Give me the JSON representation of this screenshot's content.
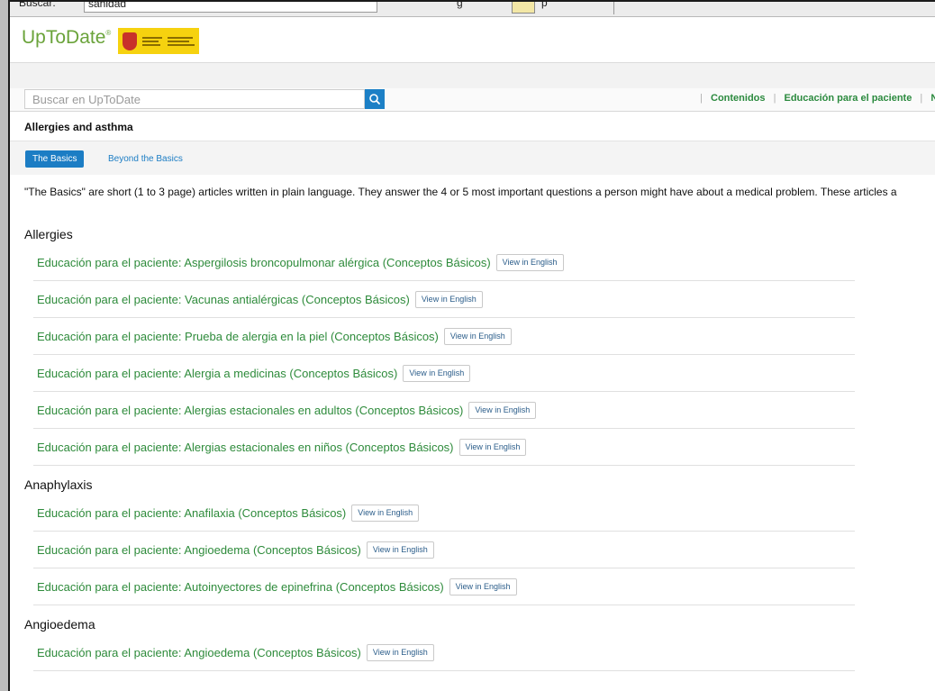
{
  "browser_top": {
    "search_label": "Buscar:",
    "search_value": "sanidad",
    "mid_text": "g",
    "right_text": "p"
  },
  "logo": {
    "name": "UpToDate",
    "mark": "®"
  },
  "search": {
    "placeholder": "Buscar en UpToDate"
  },
  "top_nav": [
    {
      "label": "Contenidos"
    },
    {
      "label": "Educación para el paciente"
    },
    {
      "label": "No"
    }
  ],
  "page": {
    "title": "Allergies and asthma"
  },
  "tabs": [
    {
      "label": "The Basics",
      "active": true
    },
    {
      "label": "Beyond the Basics",
      "active": false
    }
  ],
  "intro": "\"The Basics\" are short (1 to 3 page) articles written in plain language. They answer the 4 or 5 most important questions a person might have about a medical problem. These articles a",
  "sections": [
    {
      "heading": "Allergies",
      "items": [
        {
          "title": "Educación para el paciente: Aspergilosis broncopulmonar alérgica (Conceptos Básicos)",
          "button": "View in English"
        },
        {
          "title": "Educación para el paciente: Vacunas antialérgicas (Conceptos Básicos)",
          "button": "View in English"
        },
        {
          "title": "Educación para el paciente: Prueba de alergia en la piel (Conceptos Básicos)",
          "button": "View in English"
        },
        {
          "title": "Educación para el paciente: Alergia a medicinas (Conceptos Básicos)",
          "button": "View in English"
        },
        {
          "title": "Educación para el paciente: Alergias estacionales en adultos (Conceptos Básicos)",
          "button": "View in English"
        },
        {
          "title": "Educación para el paciente: Alergias estacionales en niños (Conceptos Básicos)",
          "button": "View in English"
        }
      ]
    },
    {
      "heading": "Anaphylaxis",
      "items": [
        {
          "title": "Educación para el paciente: Anafilaxia (Conceptos Básicos)",
          "button": "View in English"
        },
        {
          "title": "Educación para el paciente: Angioedema (Conceptos Básicos)",
          "button": "View in English"
        },
        {
          "title": "Educación para el paciente: Autoinyectores de epinefrina (Conceptos Básicos)",
          "button": "View in English"
        }
      ]
    },
    {
      "heading": "Angioedema",
      "items": [
        {
          "title": "Educación para el paciente: Angioedema (Conceptos Básicos)",
          "button": "View in English"
        }
      ]
    }
  ],
  "colors": {
    "accent_blue": "#1c7dc4",
    "link_green": "#2e8b3b",
    "logo_green": "#6aa33a",
    "ministry_yellow": "#f6d20f"
  }
}
